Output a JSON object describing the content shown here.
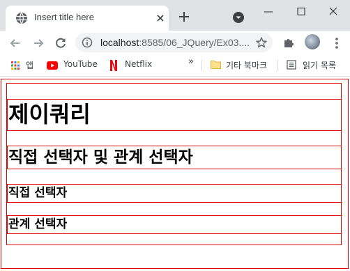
{
  "browser": {
    "tab_title": "Insert title here",
    "url_host": "localhost",
    "url_rest": ":8585/06_JQuery/Ex03....",
    "colors": {
      "tabstrip": "#dfe1e5",
      "omnibox": "#f1f3f4",
      "page_border": "#e00000"
    },
    "bookmarks": [
      {
        "label": "앱",
        "icon": "apps-grid-icon"
      },
      {
        "label": "YouTube",
        "icon": "youtube-icon"
      },
      {
        "label": "Netflix",
        "icon": "netflix-icon"
      },
      {
        "label": "기타 북마크",
        "icon": "folder-icon"
      },
      {
        "label": "읽기 목록",
        "icon": "reading-list-icon"
      }
    ],
    "overflow": "»"
  },
  "page": {
    "h1": "제이쿼리",
    "h2": "직접 선택자 및 관계 선택자",
    "h3": "직접 선택자",
    "h4": "관계 선택자"
  }
}
